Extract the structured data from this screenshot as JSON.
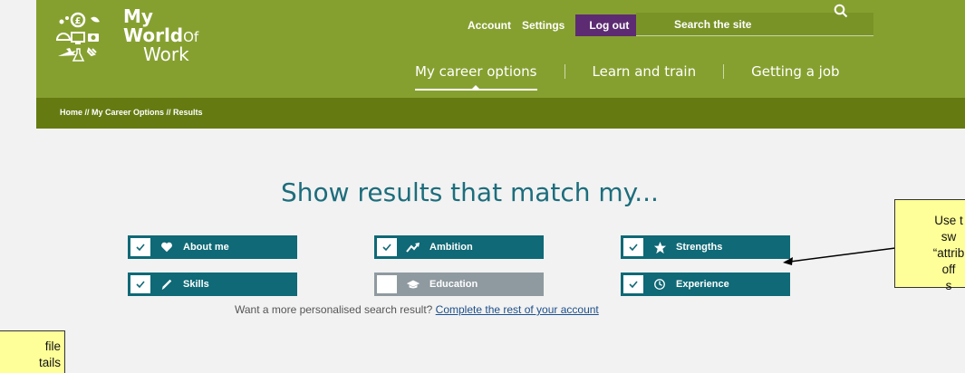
{
  "logo": {
    "my": "My",
    "world": "World",
    "of": "Of",
    "work": "Work"
  },
  "toplinks": {
    "account": "Account",
    "settings": "Settings",
    "logout": "Log out"
  },
  "search": {
    "placeholder": "Search the site"
  },
  "nav": [
    {
      "label": "My career options",
      "active": true
    },
    {
      "label": "Learn and train",
      "active": false
    },
    {
      "label": "Getting a job",
      "active": false
    }
  ],
  "breadcrumb": "Home // My Career Options // Results",
  "heading": "Show results that match my...",
  "filters": [
    {
      "label": "About me",
      "checked": true,
      "icon": "heart-icon"
    },
    {
      "label": "Ambition",
      "checked": true,
      "icon": "trend-up-icon"
    },
    {
      "label": "Strengths",
      "checked": true,
      "icon": "star-icon"
    },
    {
      "label": "Skills",
      "checked": true,
      "icon": "pencil-icon"
    },
    {
      "label": "Education",
      "checked": false,
      "icon": "graduation-cap-icon"
    },
    {
      "label": "Experience",
      "checked": true,
      "icon": "clock-icon"
    }
  ],
  "footer": {
    "prompt": "Want a more personalised search result?",
    "link": "Complete the rest of your account"
  },
  "callouts": {
    "right": [
      "Use t",
      "sw",
      "“attrib",
      "off",
      "s"
    ],
    "left": [
      "file",
      "tails"
    ]
  },
  "colors": {
    "header": "#86a030",
    "breadcrumb_bar": "#657b12",
    "logout": "#5d2b72",
    "tile_on": "#0f6976",
    "tile_off": "#8f9aa0",
    "heading": "#1d6d7c",
    "callout": "#ffff99"
  }
}
